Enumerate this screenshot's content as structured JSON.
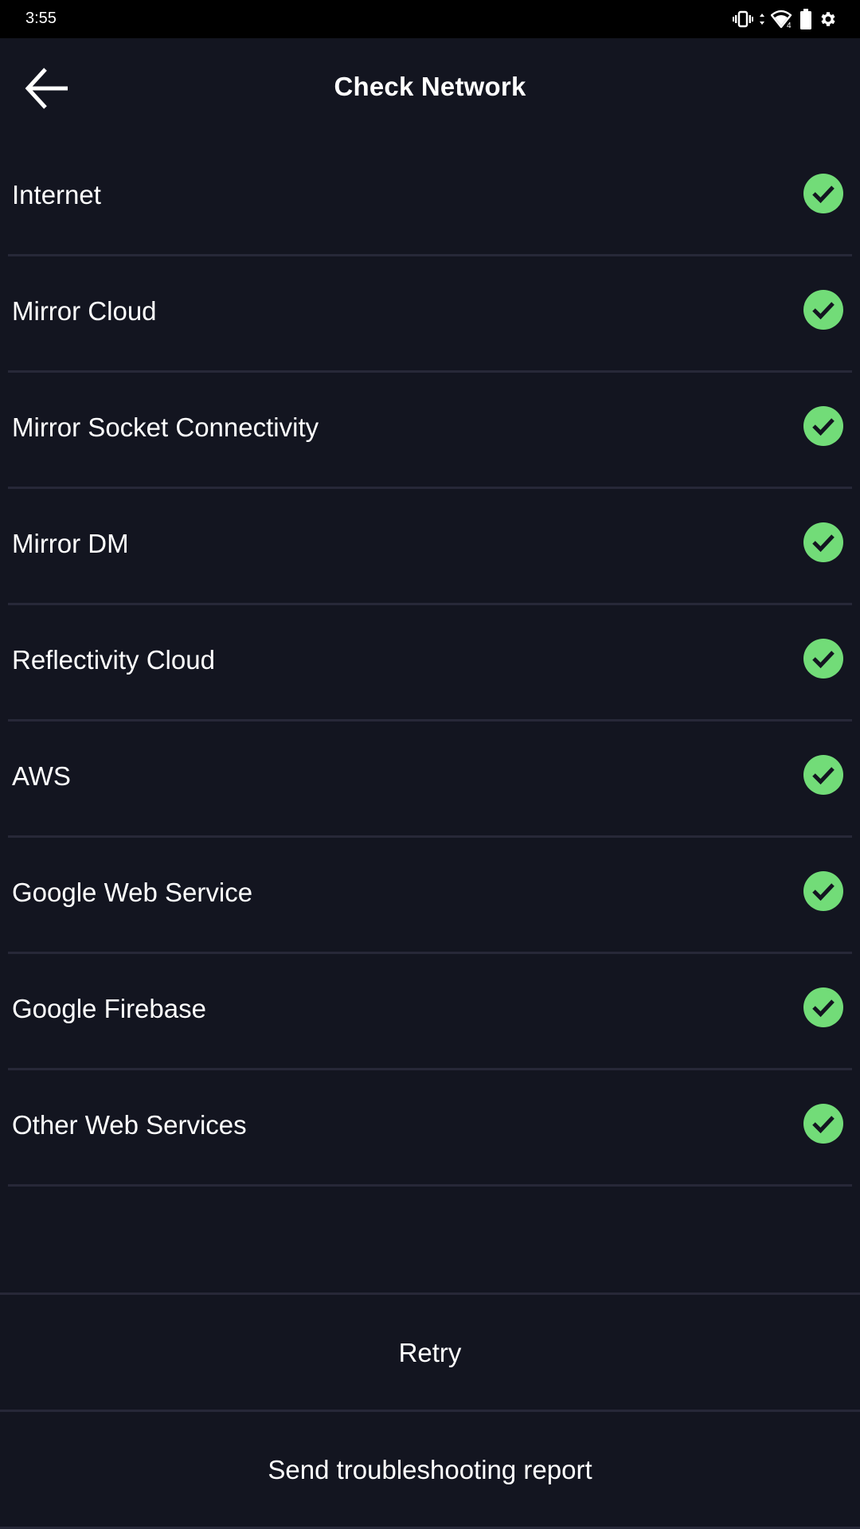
{
  "status_bar": {
    "time": "3:55",
    "icons": [
      "vibrate-icon",
      "wifi-icon",
      "battery-icon",
      "settings-gear-icon"
    ]
  },
  "header": {
    "back_icon": "arrow-left-icon",
    "title": "Check Network"
  },
  "checks": [
    {
      "label": "Internet",
      "status": "ok"
    },
    {
      "label": "Mirror Cloud",
      "status": "ok"
    },
    {
      "label": "Mirror Socket Connectivity",
      "status": "ok"
    },
    {
      "label": "Mirror DM",
      "status": "ok"
    },
    {
      "label": "Reflectivity Cloud",
      "status": "ok"
    },
    {
      "label": "AWS",
      "status": "ok"
    },
    {
      "label": "Google Web Service",
      "status": "ok"
    },
    {
      "label": "Google Firebase",
      "status": "ok"
    },
    {
      "label": "Other Web Services",
      "status": "ok"
    }
  ],
  "actions": {
    "retry": "Retry",
    "send_report": "Send troubleshooting report"
  },
  "colors": {
    "background": "#131520",
    "status_ok": "#72DC78",
    "divider": "#272838"
  }
}
